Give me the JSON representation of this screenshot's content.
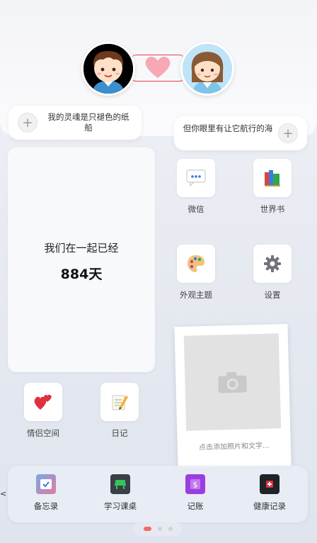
{
  "couple": {
    "left_message": "我的灵魂是只褪色的纸船",
    "right_message": "但你眼里有让它航行的海",
    "plus_symbol": "+"
  },
  "counter": {
    "title": "我们在一起已经",
    "value": "884天"
  },
  "apps": [
    {
      "label": "微信",
      "icon": "wechat-icon"
    },
    {
      "label": "世界书",
      "icon": "books-icon"
    },
    {
      "label": "外观主题",
      "icon": "palette-icon"
    },
    {
      "label": "设置",
      "icon": "gear-icon"
    },
    {
      "label": "情侣空间",
      "icon": "hearts-icon"
    },
    {
      "label": "日记",
      "icon": "memo-icon"
    }
  ],
  "polaroid": {
    "caption": "点击添加照片和文字..."
  },
  "dock": [
    {
      "label": "备忘录",
      "icon": "memo-check-icon"
    },
    {
      "label": "学习课桌",
      "icon": "desk-icon"
    },
    {
      "label": "记账",
      "icon": "dollar-icon"
    },
    {
      "label": "健康记录",
      "icon": "health-icon"
    }
  ],
  "edge_arrow": "<",
  "pager": {
    "total": 3,
    "active": 1
  },
  "colors": {
    "heart": "#f7a8b4",
    "line": "#e53c4b",
    "pager_active": "#f26b6b"
  }
}
